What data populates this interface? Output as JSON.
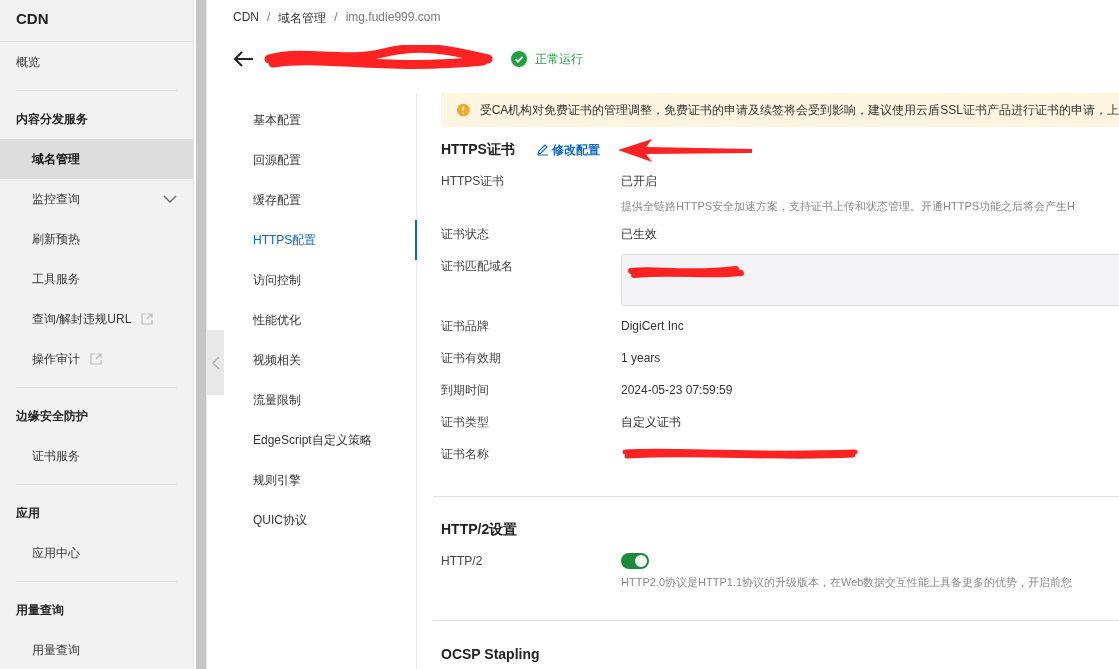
{
  "sidebar": {
    "title": "CDN",
    "groups": [
      {
        "items": [
          {
            "label": "概览",
            "selected": false,
            "expandable": false,
            "external": false
          }
        ]
      },
      {
        "title": "内容分发服务",
        "items": [
          {
            "label": "域名管理",
            "selected": true,
            "expandable": false,
            "external": false
          },
          {
            "label": "监控查询",
            "selected": false,
            "expandable": true,
            "external": false
          },
          {
            "label": "刷新预热",
            "selected": false,
            "expandable": false,
            "external": false
          },
          {
            "label": "工具服务",
            "selected": false,
            "expandable": false,
            "external": false
          },
          {
            "label": "查询/解封违规URL",
            "selected": false,
            "expandable": false,
            "external": true
          },
          {
            "label": "操作审计",
            "selected": false,
            "expandable": false,
            "external": true
          }
        ]
      },
      {
        "title": "边缘安全防护",
        "items": [
          {
            "label": "证书服务",
            "selected": false,
            "expandable": false,
            "external": false
          }
        ]
      },
      {
        "title": "应用",
        "items": [
          {
            "label": "应用中心",
            "selected": false,
            "expandable": false,
            "external": false
          }
        ]
      },
      {
        "title": "用量查询",
        "items": [
          {
            "label": "用量查询",
            "selected": false,
            "expandable": false,
            "external": false
          }
        ]
      }
    ]
  },
  "breadcrumb": [
    {
      "kind": "link",
      "label": "CDN"
    },
    {
      "kind": "separator",
      "label": "/"
    },
    {
      "kind": "link",
      "label": "域名管理"
    },
    {
      "kind": "separator",
      "label": "/"
    },
    {
      "kind": "current",
      "label": "img.fudie999.com"
    }
  ],
  "header": {
    "status": "正常运行"
  },
  "subnav": [
    {
      "label": "基本配置",
      "selected": false
    },
    {
      "label": "回源配置",
      "selected": false
    },
    {
      "label": "缓存配置",
      "selected": false
    },
    {
      "label": "HTTPS配置",
      "selected": true
    },
    {
      "label": "访问控制",
      "selected": false
    },
    {
      "label": "性能优化",
      "selected": false
    },
    {
      "label": "视频相关",
      "selected": false
    },
    {
      "label": "流量限制",
      "selected": false
    },
    {
      "label": "EdgeScript自定义策略",
      "selected": false
    },
    {
      "label": "规则引擎",
      "selected": false
    },
    {
      "label": "QUIC协议",
      "selected": false
    }
  ],
  "alert": "受CA机构对免费证书的管理调整，免费证书的申请及续签将会受到影响，建议使用云盾SSL证书产品进行证书的申请，上",
  "sections": [
    {
      "title": "HTTPS证书",
      "action": "修改配置",
      "rows": [
        {
          "kind": "text",
          "label": "HTTPS证书",
          "value": "已开启",
          "note": "提供全链路HTTPS安全加速方案，支持证书上传和状态管理。开通HTTPS功能之后将会产生H"
        },
        {
          "kind": "text",
          "label": "证书状态",
          "value": "已生效"
        },
        {
          "kind": "redacted_box",
          "label": "证书匹配域名"
        },
        {
          "kind": "text",
          "label": "证书品牌",
          "value": "DigiCert Inc"
        },
        {
          "kind": "text",
          "label": "证书有效期",
          "value": "1 years"
        },
        {
          "kind": "text",
          "label": "到期时间",
          "value": "2024-05-23 07:59:59"
        },
        {
          "kind": "text",
          "label": "证书类型",
          "value": "自定义证书"
        },
        {
          "kind": "redacted",
          "label": "证书名称"
        }
      ]
    },
    {
      "title": "HTTP/2设置",
      "rows": [
        {
          "kind": "toggle",
          "label": "HTTP/2",
          "on": true,
          "note": "HTTP2.0协议是HTTP1.1协议的升级版本，在Web数据交互性能上具备更多的优势，开启前您"
        }
      ]
    },
    {
      "title": "OCSP Stapling"
    }
  ]
}
